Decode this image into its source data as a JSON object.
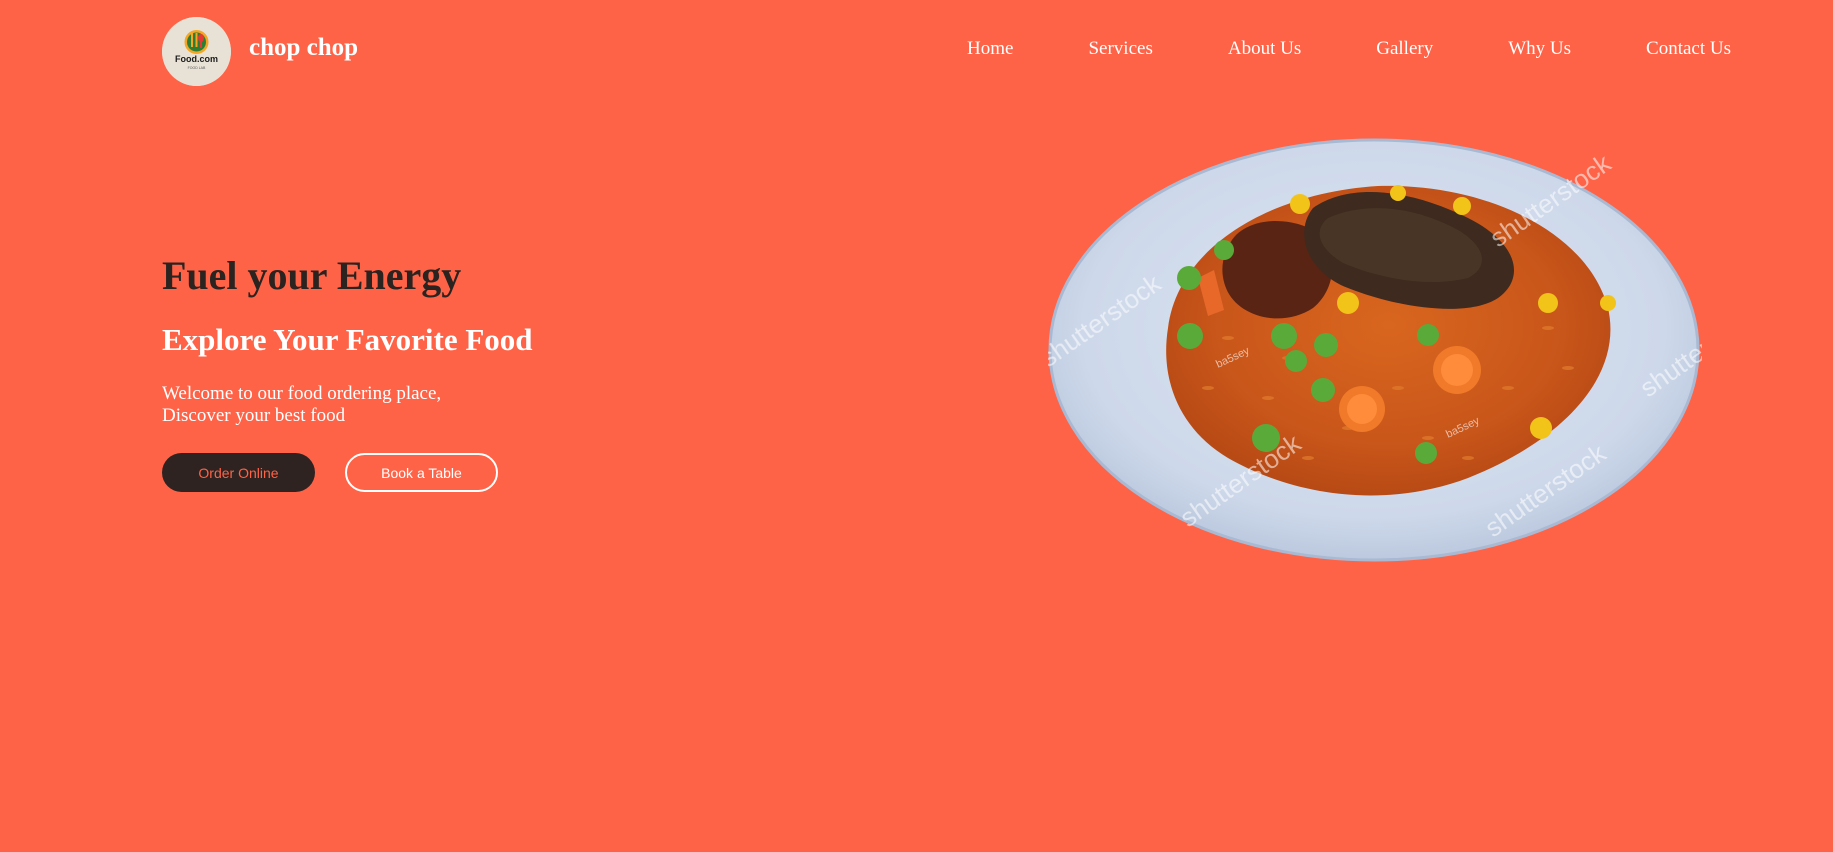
{
  "header": {
    "brand": "chop chop",
    "logo_text": "Food.com",
    "logo_tagline": "FOOD LAB",
    "nav": [
      "Home",
      "Services",
      "About Us",
      "Gallery",
      "Why Us",
      "Contact Us"
    ]
  },
  "hero": {
    "title": "Fuel your Energy",
    "subtitle": "Explore Your Favorite Food",
    "description_line1": "Welcome to our food ordering place,",
    "description_line2": "Discover your best food",
    "order_button": "Order Online",
    "book_button": "Book a Table"
  },
  "image": {
    "watermark": "shutterstock",
    "photographer_tag": "ba5sey"
  },
  "colors": {
    "background": "#ff6347",
    "dark": "#2e2320",
    "white": "#ffffff"
  }
}
